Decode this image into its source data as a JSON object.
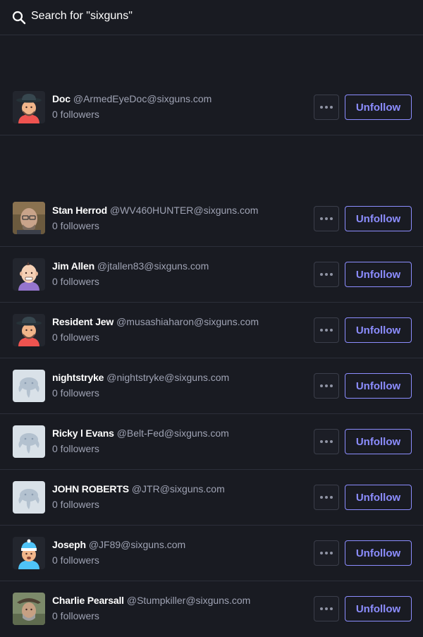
{
  "search": {
    "text": "Search for \"sixguns\""
  },
  "rows": [
    {
      "name": "Doc",
      "handle": "@ArmedEyeDoc@sixguns.com",
      "followers": "0 followers",
      "avatar": "hat-man-avatar",
      "action": "Unfollow"
    },
    {
      "name": "Stan Herrod",
      "handle": "@WV460HUNTER@sixguns.com",
      "followers": "0 followers",
      "avatar": "photo-avatar",
      "action": "Unfollow"
    },
    {
      "name": "Jim Allen",
      "handle": "@jtallen83@sixguns.com",
      "followers": "0 followers",
      "avatar": "bald-man-avatar",
      "action": "Unfollow"
    },
    {
      "name": "Resident Jew",
      "handle": "@musashiaharon@sixguns.com",
      "followers": "0 followers",
      "avatar": "hat-man-avatar",
      "action": "Unfollow"
    },
    {
      "name": "nightstryke",
      "handle": "@nightstryke@sixguns.com",
      "followers": "0 followers",
      "avatar": "mastodon-default-avatar",
      "action": "Unfollow"
    },
    {
      "name": "Ricky l Evans",
      "handle": "@Belt-Fed@sixguns.com",
      "followers": "0 followers",
      "avatar": "mastodon-default-avatar",
      "action": "Unfollow"
    },
    {
      "name": "JOHN ROBERTS",
      "handle": "@JTR@sixguns.com",
      "followers": "0 followers",
      "avatar": "mastodon-default-avatar",
      "action": "Unfollow"
    },
    {
      "name": "Joseph",
      "handle": "@JF89@sixguns.com",
      "followers": "0 followers",
      "avatar": "beanie-man-avatar",
      "action": "Unfollow"
    },
    {
      "name": "Charlie Pearsall",
      "handle": "@Stumpkiller@sixguns.com",
      "followers": "0 followers",
      "avatar": "photo-avatar",
      "action": "Unfollow"
    }
  ],
  "colors": {
    "background": "#191b22",
    "divider": "#2c2f3a",
    "accent": "#8c8dff",
    "muted_text": "#9fa3b4"
  }
}
